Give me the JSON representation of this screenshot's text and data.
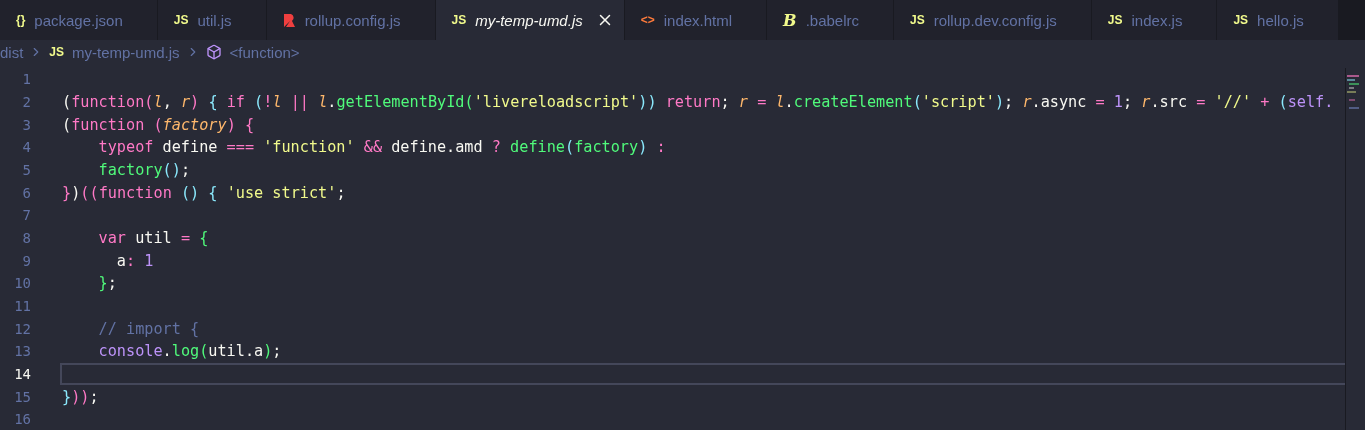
{
  "tabs": [
    {
      "label": "package.json",
      "kind": "json",
      "glyph": "{}",
      "selected": false
    },
    {
      "label": "util.js",
      "kind": "js",
      "glyph": "JS",
      "selected": false
    },
    {
      "label": "rollup.config.js",
      "kind": "rollup",
      "selected": false
    },
    {
      "label": "my-temp-umd.js",
      "kind": "js",
      "glyph": "JS",
      "selected": true
    },
    {
      "label": "index.html",
      "kind": "html",
      "glyph": "<>",
      "selected": false
    },
    {
      "label": ".babelrc",
      "kind": "babel",
      "glyph": "B",
      "selected": false
    },
    {
      "label": "rollup.dev.config.js",
      "kind": "js",
      "glyph": "JS",
      "selected": false
    },
    {
      "label": "index.js",
      "kind": "js",
      "glyph": "JS",
      "selected": false
    },
    {
      "label": "hello.js",
      "kind": "js",
      "glyph": "JS",
      "selected": false
    }
  ],
  "breadcrumb": [
    {
      "label": "dist",
      "kind": "folder"
    },
    {
      "label": "my-temp-umd.js",
      "kind": "js",
      "glyph": "JS"
    },
    {
      "label": "<function>",
      "kind": "symbol"
    }
  ],
  "lines": [
    {
      "number": "1",
      "selected": false
    },
    {
      "number": "2",
      "selected": false,
      "tokens": [
        {
          "text": "(",
          "kind": "punct"
        },
        {
          "text": "function",
          "kind": "keyword"
        },
        {
          "text": "(",
          "kind": "pink"
        },
        {
          "text": "l",
          "kind": "param"
        },
        {
          "text": ", ",
          "kind": "punct"
        },
        {
          "text": "r",
          "kind": "param"
        },
        {
          "text": ")",
          "kind": "pink"
        },
        {
          "text": " { ",
          "kind": "cyan"
        },
        {
          "text": "if",
          "kind": "keyword"
        },
        {
          "text": " (",
          "kind": "cyan"
        },
        {
          "text": "!",
          "kind": "keyword"
        },
        {
          "text": "l",
          "kind": "param"
        },
        {
          "text": " || ",
          "kind": "keyword"
        },
        {
          "text": "l",
          "kind": "param"
        },
        {
          "text": ".",
          "kind": "punct"
        },
        {
          "text": "getElementById",
          "kind": "fn"
        },
        {
          "text": "(",
          "kind": "green"
        },
        {
          "text": "'livereloadscript'",
          "kind": "string"
        },
        {
          "text": "))",
          "kind": "cyan"
        },
        {
          "text": " return",
          "kind": "keyword"
        },
        {
          "text": "; ",
          "kind": "punct"
        },
        {
          "text": "r",
          "kind": "param"
        },
        {
          "text": " = ",
          "kind": "keyword"
        },
        {
          "text": "l",
          "kind": "param"
        },
        {
          "text": ".",
          "kind": "punct"
        },
        {
          "text": "createElement",
          "kind": "fn"
        },
        {
          "text": "(",
          "kind": "cyan"
        },
        {
          "text": "'script'",
          "kind": "string"
        },
        {
          "text": ")",
          "kind": "cyan"
        },
        {
          "text": "; ",
          "kind": "punct"
        },
        {
          "text": "r",
          "kind": "param"
        },
        {
          "text": ".async",
          "kind": "punct"
        },
        {
          "text": " = ",
          "kind": "keyword"
        },
        {
          "text": "1",
          "kind": "number"
        },
        {
          "text": "; ",
          "kind": "punct"
        },
        {
          "text": "r",
          "kind": "param"
        },
        {
          "text": ".src",
          "kind": "punct"
        },
        {
          "text": " = ",
          "kind": "keyword"
        },
        {
          "text": "'//'",
          "kind": "string"
        },
        {
          "text": " + ",
          "kind": "keyword"
        },
        {
          "text": "(",
          "kind": "cyan"
        },
        {
          "text": "self.",
          "kind": "number"
        }
      ]
    },
    {
      "number": "3",
      "selected": false,
      "tokens": [
        {
          "text": "(",
          "kind": "punct"
        },
        {
          "text": "function",
          "kind": "keyword"
        },
        {
          "text": " (",
          "kind": "pink"
        },
        {
          "text": "factory",
          "kind": "param"
        },
        {
          "text": ")",
          "kind": "pink"
        },
        {
          "text": " {",
          "kind": "pink"
        }
      ],
      "children": [
        {
          "number": "4",
          "selected": false,
          "tokens": [
            {
              "text": "typeof",
              "kind": "keyword"
            },
            {
              "text": " define ",
              "kind": "punct"
            },
            {
              "text": "===",
              "kind": "keyword"
            },
            {
              "text": " 'function' ",
              "kind": "string"
            },
            {
              "text": "&&",
              "kind": "keyword"
            },
            {
              "text": " define.amd ",
              "kind": "punct"
            },
            {
              "text": "?",
              "kind": "keyword"
            },
            {
              "text": " define",
              "kind": "fn"
            },
            {
              "text": "(",
              "kind": "cyan"
            },
            {
              "text": "factory",
              "kind": "fn"
            },
            {
              "text": ")",
              "kind": "cyan"
            },
            {
              "text": " :",
              "kind": "keyword"
            }
          ]
        },
        {
          "number": "5",
          "selected": false,
          "tokens": [
            {
              "text": "factory",
              "kind": "fn"
            },
            {
              "text": "()",
              "kind": "cyan"
            },
            {
              "text": ";",
              "kind": "punct"
            }
          ]
        }
      ]
    },
    {
      "number": "6",
      "selected": false,
      "tokens": [
        {
          "text": "}",
          "kind": "pink"
        },
        {
          "text": ")",
          "kind": "punct"
        },
        {
          "text": "(",
          "kind": "pink"
        },
        {
          "text": "(",
          "kind": "pink"
        },
        {
          "text": "function",
          "kind": "keyword"
        },
        {
          "text": " () ",
          "kind": "cyan"
        },
        {
          "text": "{ ",
          "kind": "cyan"
        },
        {
          "text": "'use strict'",
          "kind": "string"
        },
        {
          "text": ";",
          "kind": "punct"
        }
      ],
      "children": [
        {
          "number": "7",
          "selected": false
        },
        {
          "number": "8",
          "selected": false,
          "tokens": [
            {
              "text": "var",
              "kind": "keyword"
            },
            {
              "text": " util ",
              "kind": "punct"
            },
            {
              "text": "=",
              "kind": "keyword"
            },
            {
              "text": " {",
              "kind": "green"
            }
          ],
          "children": [
            {
              "number": "9",
              "selected": false,
              "tokens": [
                {
                  "text": "a",
                  "kind": "punct"
                },
                {
                  "text": ":",
                  "kind": "keyword"
                },
                {
                  "text": " 1",
                  "kind": "number"
                }
              ]
            }
          ]
        },
        {
          "number": "10",
          "selected": false,
          "tokens": [
            {
              "text": "}",
              "kind": "green"
            },
            {
              "text": ";",
              "kind": "punct"
            }
          ]
        },
        {
          "number": "11",
          "selected": false
        },
        {
          "number": "12",
          "selected": false,
          "tokens": [
            {
              "text": "// import {",
              "kind": "comment"
            }
          ]
        },
        {
          "number": "13",
          "selected": false,
          "tokens": [
            {
              "text": "console",
              "kind": "number"
            },
            {
              "text": ".",
              "kind": "punct"
            },
            {
              "text": "log",
              "kind": "fn"
            },
            {
              "text": "(",
              "kind": "green"
            },
            {
              "text": "util.a",
              "kind": "punct"
            },
            {
              "text": ")",
              "kind": "green"
            },
            {
              "text": ";",
              "kind": "punct"
            }
          ]
        }
      ]
    },
    {
      "number": "14",
      "selected": true
    },
    {
      "number": "15",
      "selected": false,
      "tokens": [
        {
          "text": "}",
          "kind": "cyan"
        },
        {
          "text": "))",
          "kind": "pink"
        },
        {
          "text": ";",
          "kind": "punct"
        }
      ]
    },
    {
      "number": "16",
      "selected": false
    }
  ]
}
